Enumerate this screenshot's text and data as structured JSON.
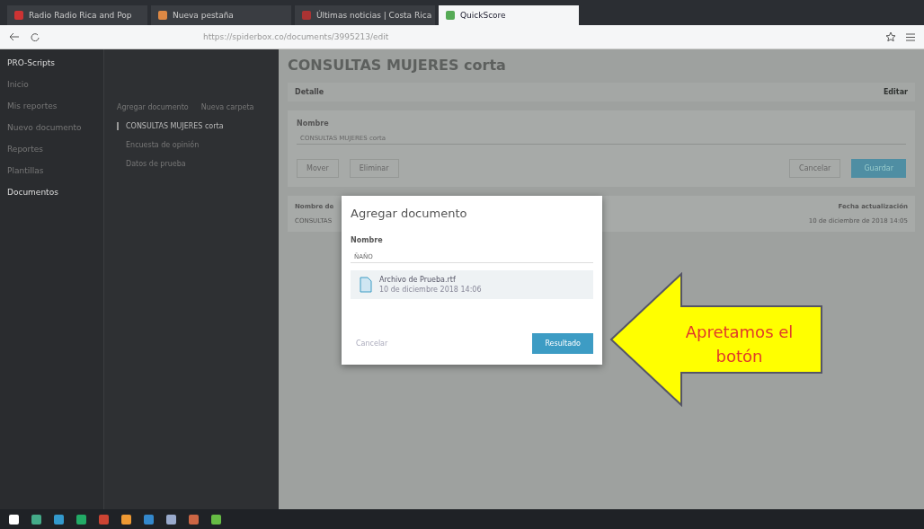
{
  "browser": {
    "tabs": [
      {
        "label": "Radio Radio Rica and Pop",
        "selected": false
      },
      {
        "label": "Nueva pestaña",
        "selected": false
      },
      {
        "label": "Últimas noticias | Costa Rica",
        "selected": false
      },
      {
        "label": "QuickScore",
        "selected": true
      }
    ],
    "url": "https://spiderbox.co/documents/3995213/edit"
  },
  "sidebar": {
    "brand": "PRO-Scripts",
    "items": [
      {
        "label": "Inicio",
        "selected": false
      },
      {
        "label": "Mis reportes",
        "selected": false
      },
      {
        "label": "Nuevo documento",
        "selected": false
      },
      {
        "label": "Reportes",
        "selected": false
      },
      {
        "label": "Plantillas",
        "selected": false
      },
      {
        "label": "Documentos",
        "selected": true
      }
    ],
    "tree_actions": [
      "Agregar documento",
      "Nueva carpeta"
    ],
    "documents": [
      {
        "label": "CONSULTAS MUJERES corta",
        "selected": true
      },
      {
        "label": "Encuesta de opinión",
        "selected": false
      },
      {
        "label": "Datos de prueba",
        "selected": false
      }
    ]
  },
  "main": {
    "title": "CONSULTAS MUJERES corta",
    "tabs": [
      {
        "label": "Detalle",
        "selected": true
      },
      {
        "label": "Editar",
        "selected": false
      }
    ],
    "field_label": "Nombre",
    "field_value": "CONSULTAS MUJERES corta",
    "actions": [
      "Mover",
      "Eliminar"
    ],
    "cancel": "Cancelar",
    "save": "Guardar",
    "table": {
      "columns": [
        "Nombre de",
        "Fecha actualización"
      ],
      "rows": [
        [
          "CONSULTAS",
          "10 de diciembre de 2018 14:05"
        ]
      ]
    }
  },
  "modal": {
    "title": "Agregar documento",
    "field_label": "Nombre",
    "field_value": "ÑAÑO",
    "file": {
      "name": "Archivo de Prueba.rtf",
      "date": "10 de diciembre 2018 14:06"
    },
    "cancel": "Cancelar",
    "submit": "Resultado"
  },
  "callout": {
    "text": "Apretamos el botón"
  }
}
